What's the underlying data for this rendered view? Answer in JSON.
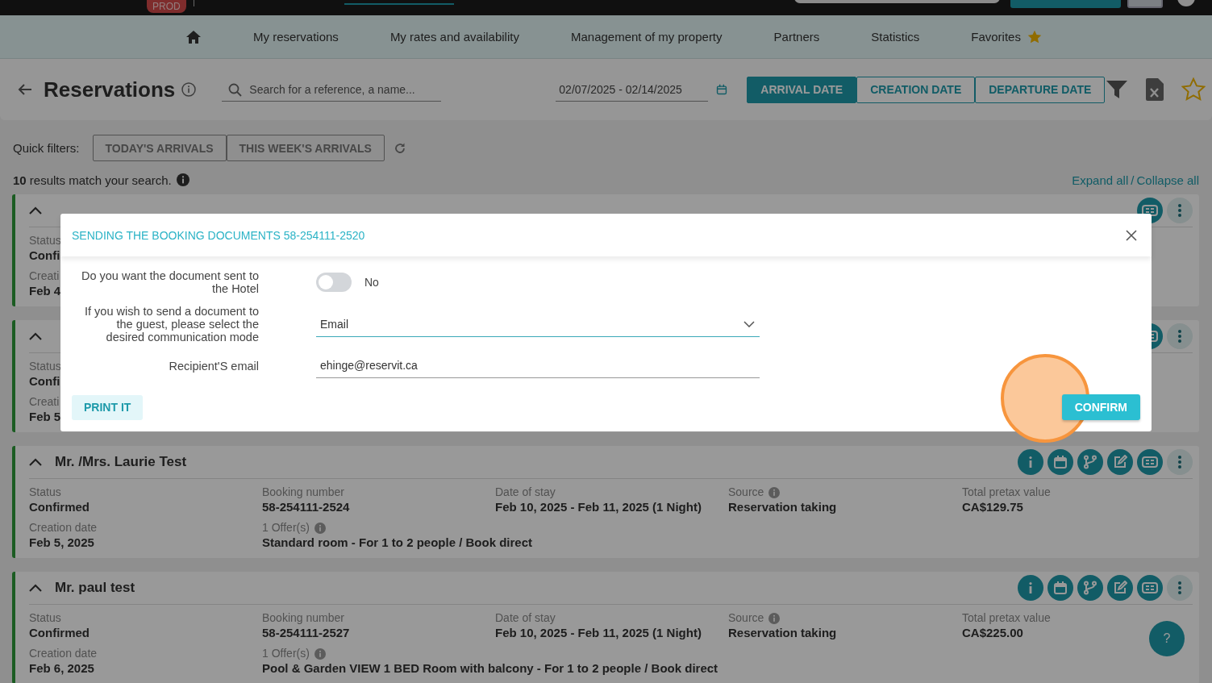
{
  "top_bar": {
    "env_badge": "PROD"
  },
  "nav": [
    {
      "kind": "home"
    },
    {
      "kind": "link",
      "label": "My reservations"
    },
    {
      "kind": "link",
      "label": "My rates and availability"
    },
    {
      "kind": "link",
      "label": "Management of my property"
    },
    {
      "kind": "link",
      "label": "Partners"
    },
    {
      "kind": "link",
      "label": "Statistics"
    },
    {
      "kind": "favorites",
      "label": "Favorites"
    }
  ],
  "header": {
    "title": "Reservations",
    "search": {
      "placeholder": "Search for a reference, a name..."
    },
    "date_range": "02/07/2025 - 02/14/2025",
    "date_modes": [
      {
        "label": "ARRIVAL DATE",
        "selected": true
      },
      {
        "label": "CREATION DATE",
        "selected": false
      },
      {
        "label": "DEPARTURE DATE",
        "selected": false
      }
    ]
  },
  "quick_filters": {
    "label": "Quick filters:",
    "buttons": [
      "TODAY'S ARRIVALS",
      "THIS WEEK'S ARRIVALS"
    ]
  },
  "results": {
    "text": "**10** results match your search.",
    "expand": "Expand all",
    "separator": "/",
    "collapse": "Collapse all"
  },
  "cards": [
    {
      "kind": "partial",
      "fields": [
        {
          "label": "Status",
          "value": "Confi",
          "info": false
        }
      ],
      "fields_2": [
        {
          "label": "Creati",
          "value": "Feb 4",
          "info": false
        }
      ]
    },
    {
      "kind": "partial",
      "fields": [
        {
          "label": "Status",
          "value": "Confi",
          "info": false
        }
      ],
      "fields_2": [
        {
          "label": "Creati",
          "value": "Feb 5",
          "info": false
        }
      ]
    },
    {
      "kind": "full",
      "name": "Mr. /Mrs. Laurie Test",
      "fields": [
        {
          "label": "Status",
          "value": "Confirmed",
          "info": false
        },
        {
          "label": "Booking number",
          "value": "58-254111-2524",
          "info": false
        },
        {
          "label": "Date of stay",
          "value": "Feb 10, 2025 - Feb 11, 2025 (1 Night)",
          "info": false
        },
        {
          "label": "Source",
          "value": "Reservation taking",
          "info": true
        },
        {
          "label": "Total pretax value",
          "value": "CA$129.75",
          "info": false
        }
      ],
      "fields_2": [
        {
          "label": "Creation date",
          "value": "Feb 5, 2025",
          "info": false
        },
        {
          "label": "1 Offer(s)",
          "value": "Standard room - For 1 to 2 people / Book direct",
          "info": true
        }
      ]
    },
    {
      "kind": "full",
      "name": "Mr. paul test",
      "fields": [
        {
          "label": "Status",
          "value": "Confirmed",
          "info": false
        },
        {
          "label": "Booking number",
          "value": "58-254111-2527",
          "info": false
        },
        {
          "label": "Date of stay",
          "value": "Feb 10, 2025 - Feb 11, 2025 (1 Night)",
          "info": false
        },
        {
          "label": "Source",
          "value": "Reservation taking",
          "info": true
        },
        {
          "label": "Total pretax value",
          "value": "CA$225.00",
          "info": false
        }
      ],
      "fields_2": [
        {
          "label": "Creation date",
          "value": "Feb 6, 2025",
          "info": false
        },
        {
          "label": "1 Offer(s)",
          "value": "Pool & Garden VIEW 1 BED Room with balcony - For 1 to 2 people / Book direct",
          "info": true
        }
      ]
    }
  ],
  "help_button": "?",
  "modal": {
    "title": "SENDING THE BOOKING DOCUMENTS 58-254111-2520",
    "hotel_toggle": {
      "label": "Do you want the document sent to the Hotel",
      "on": false,
      "state_text": "No"
    },
    "mode_select": {
      "label": "If you wish to send a document to the guest, please select the desired communication mode",
      "value": "Email"
    },
    "email": {
      "label": "Recipient'S email",
      "value": "ehinge@reservit.ca"
    },
    "print_button": "PRINT IT",
    "confirm_button": "CONFIRM"
  }
}
